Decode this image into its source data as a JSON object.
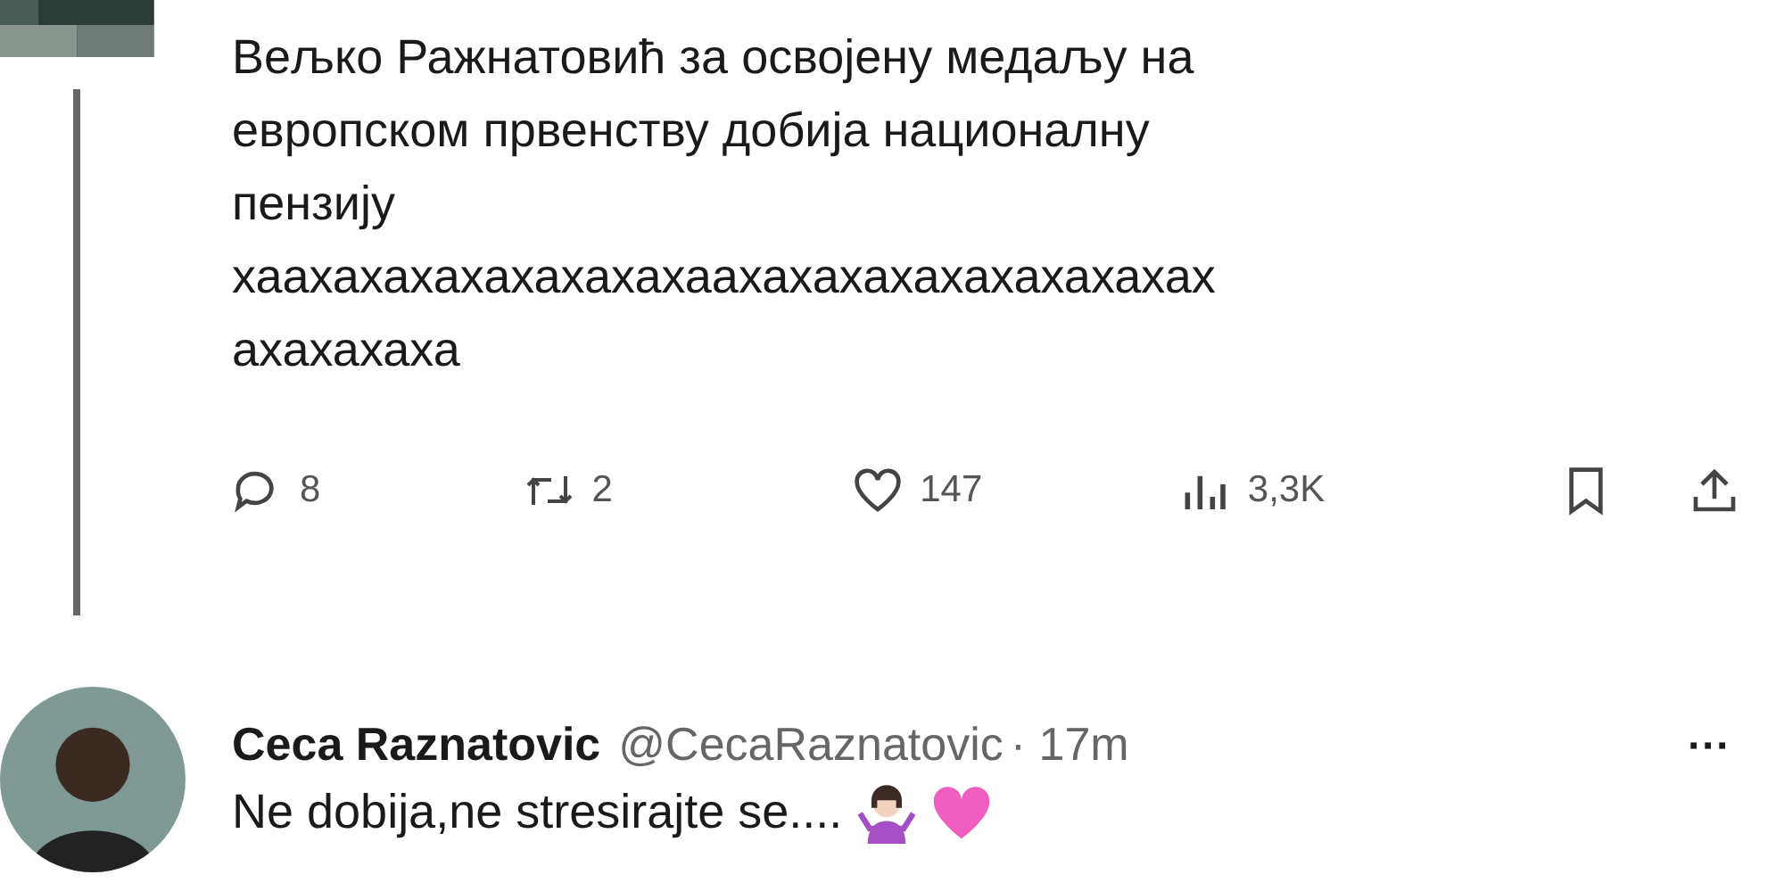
{
  "parent_tweet": {
    "avatar": {
      "kind": "picture"
    },
    "text_lines": [
      "Вељко Ражнатовић за освојену медаљу на",
      "европском првенству добија националну",
      "пензију",
      "хаахахахахахахахахаахахахахахахахахахах",
      "ахахахаха"
    ],
    "actions": [
      {
        "kind": "reply",
        "count": "8"
      },
      {
        "kind": "repost",
        "count": "2"
      },
      {
        "kind": "like",
        "count": "147"
      },
      {
        "kind": "views",
        "count": "3,3K"
      },
      {
        "kind": "bookmark"
      },
      {
        "kind": "share"
      }
    ]
  },
  "reply_tweet": {
    "name": "Ceca Raznatovic",
    "handle": "@CecaRaznatovic",
    "time": "· 17m",
    "more": "···",
    "text": "Ne dobija,ne stresirajte se....",
    "emoji": [
      {
        "kind": "shrug"
      },
      {
        "kind": "pink-heart"
      }
    ]
  }
}
